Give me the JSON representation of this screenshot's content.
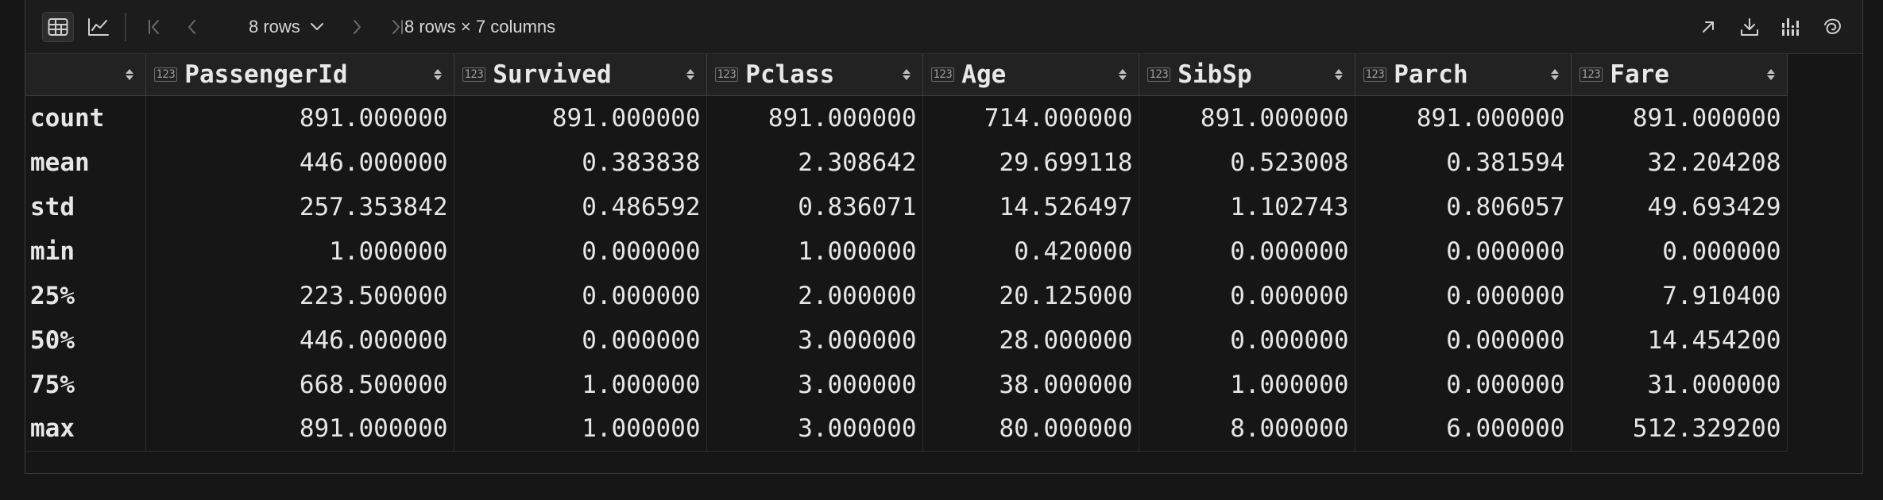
{
  "toolbar": {
    "rows_selector": "8 rows",
    "summary": "8 rows × 7 columns"
  },
  "icons": {
    "table_view": "table-icon",
    "chart_view": "line-chart-icon",
    "first_page": "first-page-icon",
    "prev_page": "chevron-left-icon",
    "dropdown": "chevron-down-icon",
    "next_page": "chevron-right-icon",
    "last_page": "last-page-icon",
    "open_external": "arrow-up-right-icon",
    "download": "download-icon",
    "column_stats": "column-stats-icon",
    "swirl": "swirl-icon"
  },
  "table": {
    "type_badge": "123",
    "columns": [
      "PassengerId",
      "Survived",
      "Pclass",
      "Age",
      "SibSp",
      "Parch",
      "Fare"
    ],
    "rows": [
      {
        "label": "count",
        "values": [
          "891.000000",
          "891.000000",
          "891.000000",
          "714.000000",
          "891.000000",
          "891.000000",
          "891.000000"
        ]
      },
      {
        "label": "mean",
        "values": [
          "446.000000",
          "0.383838",
          "2.308642",
          "29.699118",
          "0.523008",
          "0.381594",
          "32.204208"
        ]
      },
      {
        "label": "std",
        "values": [
          "257.353842",
          "0.486592",
          "0.836071",
          "14.526497",
          "1.102743",
          "0.806057",
          "49.693429"
        ]
      },
      {
        "label": "min",
        "values": [
          "1.000000",
          "0.000000",
          "1.000000",
          "0.420000",
          "0.000000",
          "0.000000",
          "0.000000"
        ]
      },
      {
        "label": "25%",
        "values": [
          "223.500000",
          "0.000000",
          "2.000000",
          "20.125000",
          "0.000000",
          "0.000000",
          "7.910400"
        ]
      },
      {
        "label": "50%",
        "values": [
          "446.000000",
          "0.000000",
          "3.000000",
          "28.000000",
          "0.000000",
          "0.000000",
          "14.454200"
        ]
      },
      {
        "label": "75%",
        "values": [
          "668.500000",
          "1.000000",
          "3.000000",
          "38.000000",
          "1.000000",
          "0.000000",
          "31.000000"
        ]
      },
      {
        "label": "max",
        "values": [
          "891.000000",
          "1.000000",
          "3.000000",
          "80.000000",
          "8.000000",
          "6.000000",
          "512.329200"
        ]
      }
    ]
  },
  "colors": {
    "background": "#161616",
    "toolbar": "#1c1c1c",
    "header": "#222222",
    "text": "#e6e6e6",
    "border": "#3c3c3c"
  }
}
